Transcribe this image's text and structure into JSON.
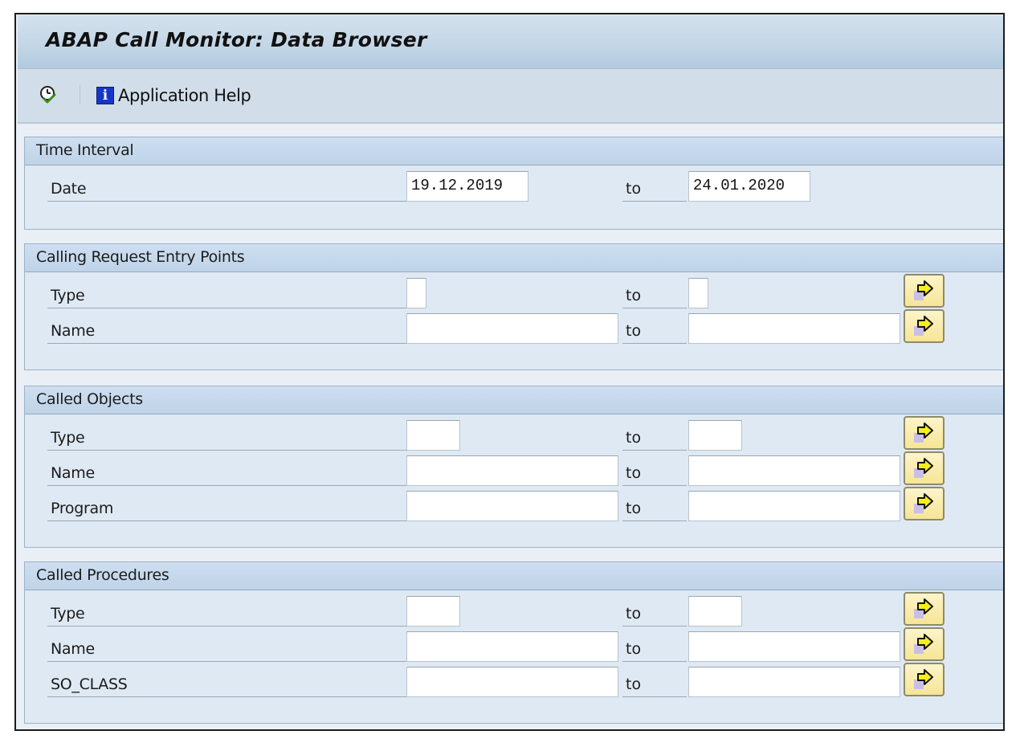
{
  "window": {
    "title": "ABAP Call Monitor: Data Browser"
  },
  "toolbar": {
    "execute_icon": "execute-clock-check-icon",
    "help_icon": "info-icon",
    "help_label": "Application Help"
  },
  "sections": {
    "time_interval": {
      "title": "Time Interval",
      "rows": [
        {
          "label": "Date",
          "from": "19.12.2019",
          "to_label": "to",
          "to": "24.01.2020"
        }
      ]
    },
    "calling_request": {
      "title": "Calling Request Entry Points",
      "rows": [
        {
          "label": "Type",
          "from": "",
          "to_label": "to",
          "to": "",
          "multi_icon": "multiple-selection-arrow-icon"
        },
        {
          "label": "Name",
          "from": "",
          "to_label": "to",
          "to": "",
          "multi_icon": "multiple-selection-arrow-icon"
        }
      ]
    },
    "called_objects": {
      "title": "Called Objects",
      "rows": [
        {
          "label": "Type",
          "from": "",
          "to_label": "to",
          "to": "",
          "multi_icon": "multiple-selection-arrow-icon"
        },
        {
          "label": "Name",
          "from": "",
          "to_label": "to",
          "to": "",
          "multi_icon": "multiple-selection-arrow-icon"
        },
        {
          "label": "Program",
          "from": "",
          "to_label": "to",
          "to": "",
          "multi_icon": "multiple-selection-arrow-icon"
        }
      ]
    },
    "called_procedures": {
      "title": "Called Procedures",
      "rows": [
        {
          "label": "Type",
          "from": "",
          "to_label": "to",
          "to": "",
          "multi_icon": "multiple-selection-arrow-icon"
        },
        {
          "label": "Name",
          "from": "",
          "to_label": "to",
          "to": "",
          "multi_icon": "multiple-selection-arrow-icon"
        },
        {
          "label": "SO_CLASS",
          "from": "",
          "to_label": "to",
          "to": "",
          "multi_icon": "multiple-selection-arrow-icon"
        }
      ]
    }
  },
  "colors": {
    "title_bar": "#c4d7e7",
    "section_header": "#c6d9ec",
    "section_body": "#dfe9f3",
    "multi_button": "#f8ebab",
    "info_icon": "#1537c8"
  }
}
